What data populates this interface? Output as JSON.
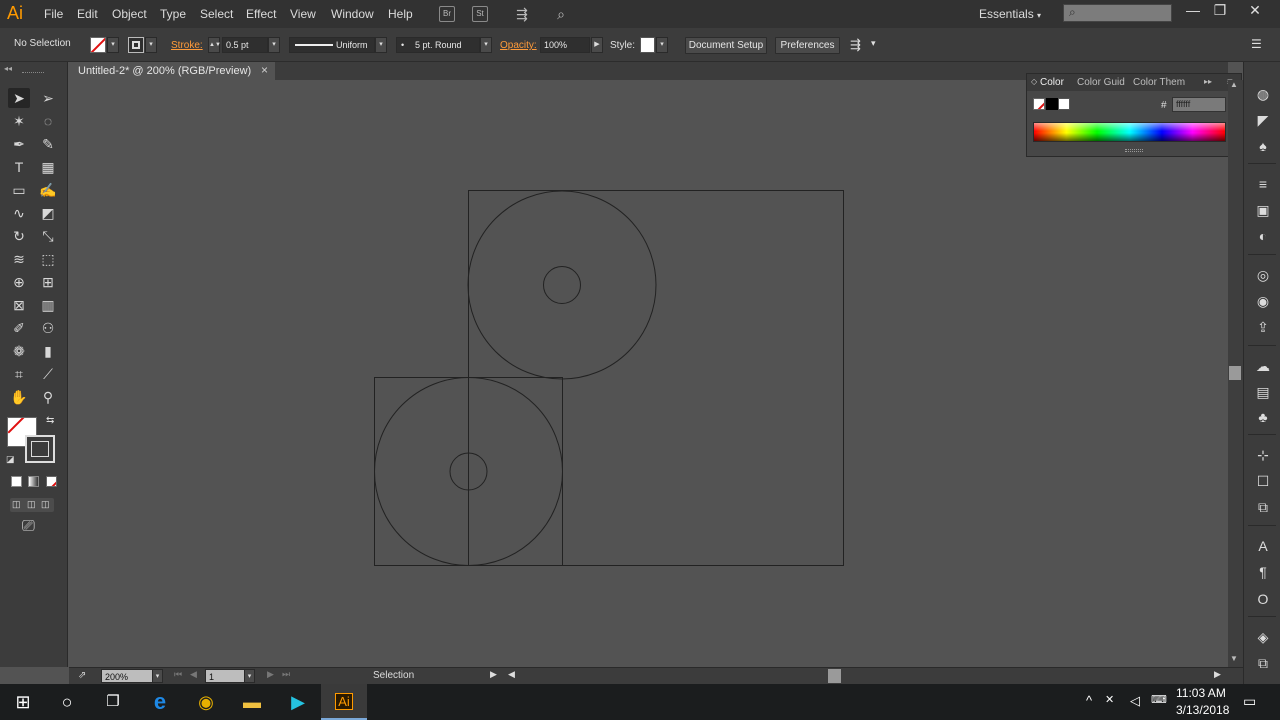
{
  "app": {
    "logo": "Ai",
    "menus": [
      "File",
      "Edit",
      "Object",
      "Type",
      "Select",
      "Effect",
      "View",
      "Window",
      "Help"
    ],
    "bridge_label": "Br",
    "stock_label": "St",
    "workspace": "Essentials",
    "workspace_caret": "▾",
    "search_icon_glyph": "⌕",
    "window_minimize": "—",
    "window_restore": "❐",
    "window_close": "✕"
  },
  "control_bar": {
    "selection_status": "No Selection",
    "stroke_label": "Stroke:",
    "stroke_weight": "0.5 pt",
    "stroke_profile": "Uniform",
    "brush": "5 pt. Round",
    "opacity_label": "Opacity:",
    "opacity_value": "100%",
    "style_label": "Style:",
    "document_setup": "Document Setup",
    "preferences": "Preferences",
    "dropdown_glyph": "▾",
    "arrange_icon_glyph": "⇶",
    "panel_menu_glyph": "☰"
  },
  "document": {
    "tab_title": "Untitled-2* @ 200% (RGB/Preview)",
    "close_glyph": "×"
  },
  "color_panel": {
    "tabs": [
      "Color",
      "Color Guid",
      "Color Them"
    ],
    "hex_symbol": "#",
    "hex_value": "ffffff",
    "expand_glyph": "▸▸",
    "menu_glyph": "≡"
  },
  "status_bar": {
    "zoom": "200%",
    "artboard_number": "1",
    "tool_status": "Selection",
    "nav_first": "⏮",
    "nav_prev": "◀",
    "nav_next": "▶",
    "nav_last": "⏭",
    "play_glyph": "▶"
  },
  "toolbar": {
    "tools": [
      {
        "name": "selection-tool",
        "glyph": "➤"
      },
      {
        "name": "direct-selection-tool",
        "glyph": "➢"
      },
      {
        "name": "magic-wand-tool",
        "glyph": "✶"
      },
      {
        "name": "lasso-tool",
        "glyph": "◌"
      },
      {
        "name": "pen-tool",
        "glyph": "✒"
      },
      {
        "name": "curvature-tool",
        "glyph": "✎"
      },
      {
        "name": "type-tool",
        "glyph": "T"
      },
      {
        "name": "line-segment-tool",
        "glyph": "▦"
      },
      {
        "name": "rectangle-tool",
        "glyph": "▭"
      },
      {
        "name": "paintbrush-tool",
        "glyph": "✍"
      },
      {
        "name": "shaper-tool",
        "glyph": "∿"
      },
      {
        "name": "eraser-tool",
        "glyph": "◩"
      },
      {
        "name": "rotate-tool",
        "glyph": "↻"
      },
      {
        "name": "scale-tool",
        "glyph": "⤡"
      },
      {
        "name": "width-tool",
        "glyph": "≋"
      },
      {
        "name": "free-transform-tool",
        "glyph": "⬚"
      },
      {
        "name": "shape-builder-tool",
        "glyph": "⊕"
      },
      {
        "name": "perspective-grid-tool",
        "glyph": "⊞"
      },
      {
        "name": "mesh-tool",
        "glyph": "⊠"
      },
      {
        "name": "gradient-tool",
        "glyph": "▥"
      },
      {
        "name": "eyedropper-tool",
        "glyph": "✐"
      },
      {
        "name": "blend-tool",
        "glyph": "⚇"
      },
      {
        "name": "symbol-sprayer-tool",
        "glyph": "❁"
      },
      {
        "name": "column-graph-tool",
        "glyph": "▮"
      },
      {
        "name": "artboard-tool",
        "glyph": "⌗"
      },
      {
        "name": "slice-tool",
        "glyph": "⟋"
      },
      {
        "name": "hand-tool",
        "glyph": "✋"
      },
      {
        "name": "zoom-tool",
        "glyph": "⚲"
      }
    ],
    "swap_glyph": "⇆",
    "default_colors_glyph": "◪",
    "change_screen_mode_glyph": "⎚"
  },
  "right_dock": {
    "icons": [
      "color-guide-icon",
      "brushes-icon",
      "symbols-icon",
      "stroke-icon",
      "gradient-icon",
      "transparency-icon",
      "appearance-icon",
      "graphic-styles-icon",
      "export-icon",
      "libraries-icon",
      "asset-export-icon",
      "image-trace-icon",
      "align-icon",
      "transform-icon",
      "pathfinder-icon",
      "character-icon",
      "paragraph-icon",
      "opentype-icon",
      "layers-icon",
      "artboards-icon"
    ],
    "glyphs": [
      "◍",
      "◤",
      "♠",
      "≡",
      "▣",
      "◐",
      "◎",
      "◉",
      "⇪",
      "☁",
      "▤",
      "♣",
      "⊹",
      "☐",
      "⧉",
      "A",
      "¶",
      "O",
      "◈",
      "⧉"
    ]
  },
  "taskbar": {
    "time": "11:03 AM",
    "date": "3/13/2018",
    "start_glyph": "⊞",
    "search_glyph": "○",
    "taskview_glyph": "❐",
    "edge_glyph": "e",
    "chrome_glyph": "◉",
    "explorer_glyph": "▬",
    "media_glyph": "▶",
    "illustrator_label": "Ai",
    "tray_up": "^",
    "tray_network": "✕",
    "tray_volume": "◁",
    "tray_notify": "▭"
  },
  "colors": {
    "chrome_dark": "#323232",
    "panel": "#3c3c3c",
    "canvas": "#535353",
    "artwork_stroke": "#222222",
    "accent_orange": "#ff9a00"
  }
}
